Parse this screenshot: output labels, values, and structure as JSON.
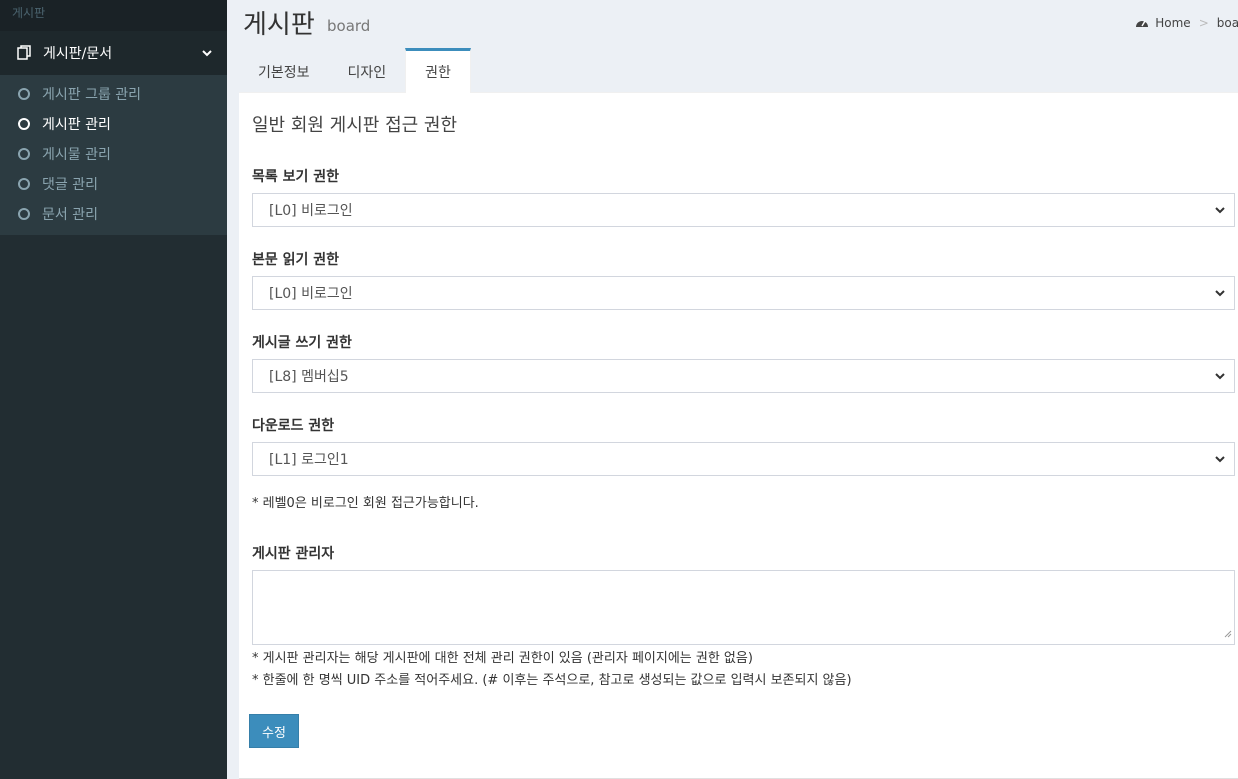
{
  "sidebar": {
    "header": "게시판",
    "parent_label": "게시판/문서",
    "items": [
      {
        "label": "게시판 그룹 관리",
        "active": false
      },
      {
        "label": "게시판 관리",
        "active": true
      },
      {
        "label": "게시물 관리",
        "active": false
      },
      {
        "label": "댓글 관리",
        "active": false
      },
      {
        "label": "문서 관리",
        "active": false
      }
    ]
  },
  "header": {
    "title": "게시판",
    "subtitle": "board",
    "breadcrumb_home": "Home",
    "breadcrumb_current": "boar"
  },
  "tabs": [
    {
      "label": "기본정보",
      "active": false
    },
    {
      "label": "디자인",
      "active": false
    },
    {
      "label": "권한",
      "active": true
    }
  ],
  "form": {
    "section_title": "일반 회원 게시판 접근 권한",
    "fields": [
      {
        "label": "목록 보기 권한",
        "value": "[L0] 비로그인"
      },
      {
        "label": "본문 읽기 권한",
        "value": "[L0] 비로그인"
      },
      {
        "label": "게시글 쓰기 권한",
        "value": "[L8] 멤버십5"
      },
      {
        "label": "다운로드 권한",
        "value": "[L1] 로그인1"
      }
    ],
    "level_help": "* 레벨0은 비로그인 회원 접근가능합니다.",
    "admin_label": "게시판 관리자",
    "admin_value": "",
    "admin_help_1": "* 게시판 관리자는 해당 게시판에 대한 전체 관리 권한이 있음 (관리자 페이지에는 권한 없음)",
    "admin_help_2": "* 한줄에 한 명씩 UID 주소를 적어주세요. (# 이후는 주석으로, 참고로 생성되는 값으로 입력시 보존되지 않음)",
    "submit_label": "수정"
  },
  "colors": {
    "sidebar_bg": "#222d32",
    "accent": "#3c8dbc"
  }
}
